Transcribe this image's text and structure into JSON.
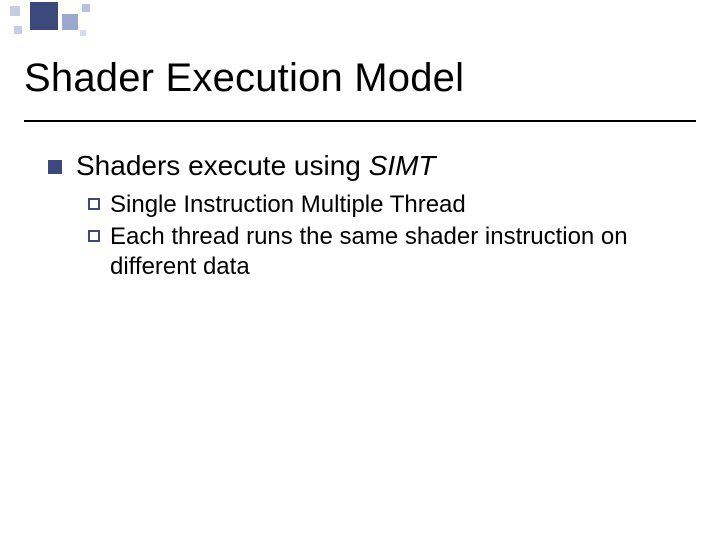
{
  "title": "Shader Execution Model",
  "bullets": {
    "lvl1": {
      "prefix": "Shaders execute using ",
      "emph": "SIMT"
    },
    "lvl2": [
      "Single Instruction Multiple Thread",
      "Each thread runs the same shader instruction on different data"
    ]
  }
}
